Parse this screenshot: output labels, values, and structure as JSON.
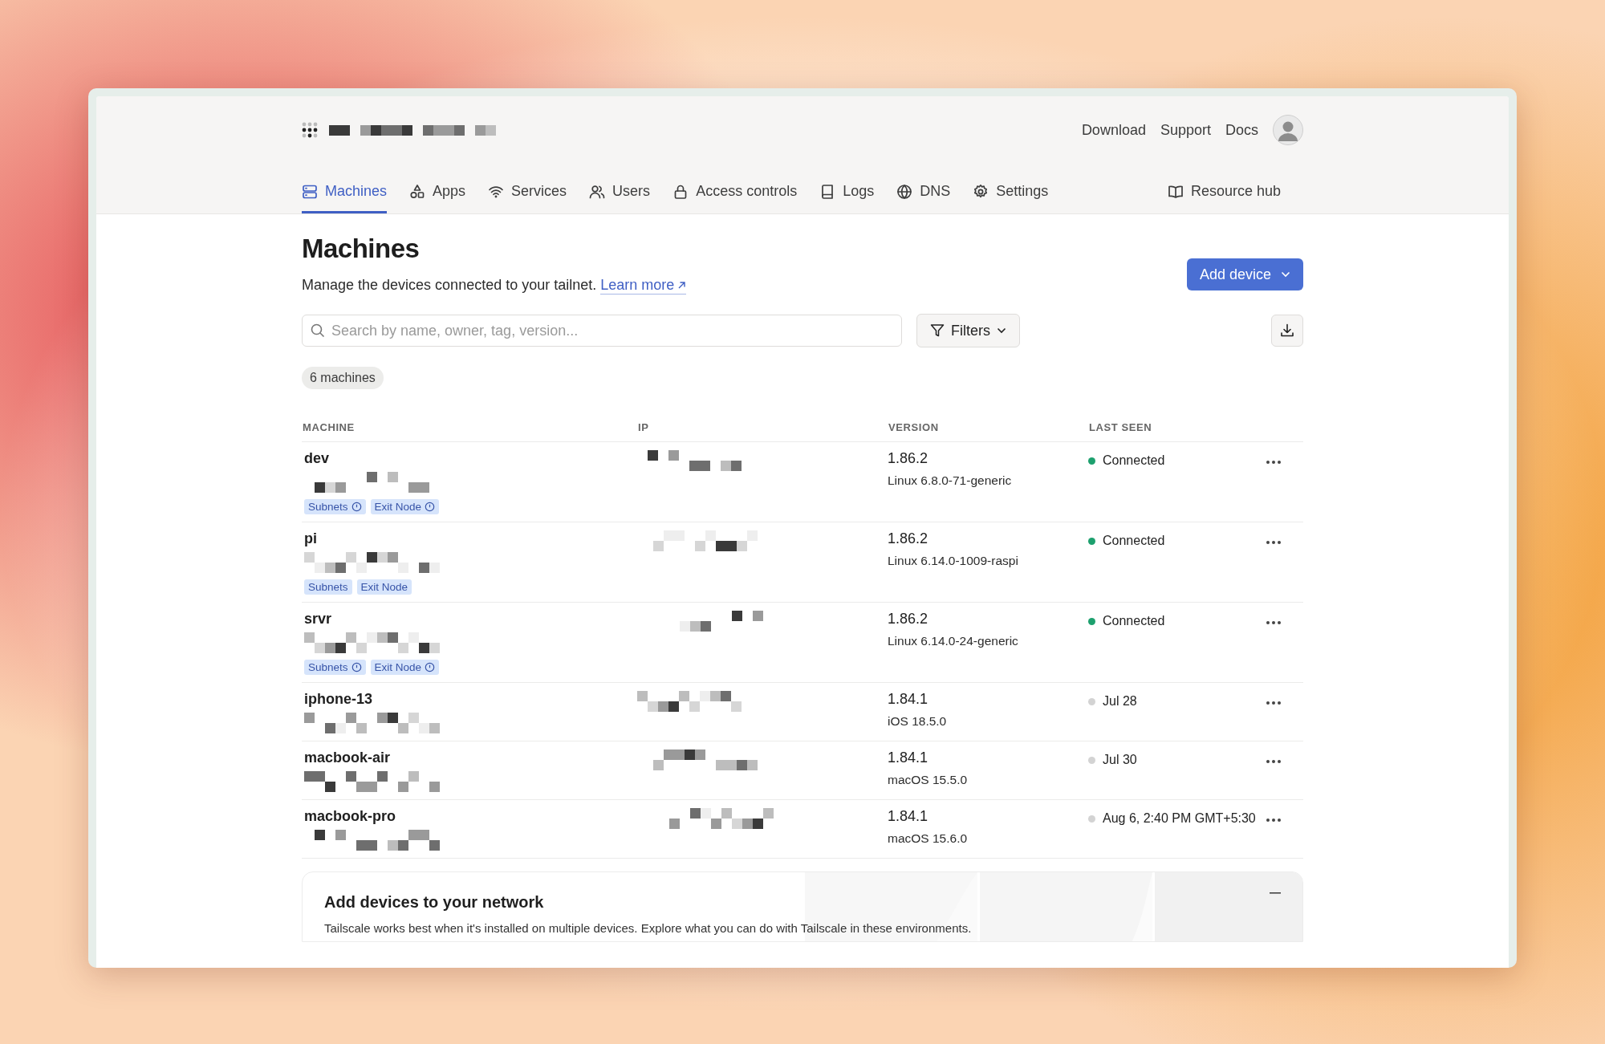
{
  "top_links": [
    "Download",
    "Support",
    "Docs"
  ],
  "nav_tabs": [
    {
      "label": "Machines",
      "selected": true
    },
    {
      "label": "Apps",
      "selected": false
    },
    {
      "label": "Services",
      "selected": false
    },
    {
      "label": "Users",
      "selected": false
    },
    {
      "label": "Access controls",
      "selected": false
    },
    {
      "label": "Logs",
      "selected": false
    },
    {
      "label": "DNS",
      "selected": false
    },
    {
      "label": "Settings",
      "selected": false
    }
  ],
  "resource_hub": "Resource hub",
  "page": {
    "title": "Machines",
    "description": "Manage the devices connected to your tailnet.",
    "link": "Learn more"
  },
  "add_device_button": "Add device",
  "search": {
    "placeholder": "Search by name, owner, tag, version..."
  },
  "filters_button": "Filters",
  "count_badge": "6 machines",
  "table": {
    "columns": [
      "MACHINE",
      "IP",
      "VERSION",
      "LAST SEEN"
    ],
    "rows": [
      {
        "name": "dev",
        "tags": [
          {
            "label": "Subnets",
            "info": true
          },
          {
            "label": "Exit Node",
            "info": true
          }
        ],
        "version": "1.86.2",
        "os": "Linux 6.8.0-71-generic",
        "last_seen": "Connected",
        "connected": true
      },
      {
        "name": "pi",
        "tags": [
          {
            "label": "Subnets",
            "info": false
          },
          {
            "label": "Exit Node",
            "info": false
          }
        ],
        "version": "1.86.2",
        "os": "Linux 6.14.0-1009-raspi",
        "last_seen": "Connected",
        "connected": true
      },
      {
        "name": "srvr",
        "tags": [
          {
            "label": "Subnets",
            "info": true
          },
          {
            "label": "Exit Node",
            "info": true
          }
        ],
        "version": "1.86.2",
        "os": "Linux 6.14.0-24-generic",
        "last_seen": "Connected",
        "connected": true
      },
      {
        "name": "iphone-13",
        "version": "1.84.1",
        "os": "iOS 18.5.0",
        "last_seen": "Jul 28",
        "connected": false
      },
      {
        "name": "macbook-air",
        "version": "1.84.1",
        "os": "macOS 15.5.0",
        "last_seen": "Jul 30",
        "connected": false
      },
      {
        "name": "macbook-pro",
        "version": "1.84.1",
        "os": "macOS 15.6.0",
        "last_seen": "Aug 6, 2:40 PM GMT+5:30",
        "connected": false
      }
    ]
  },
  "add_devices_card": {
    "title": "Add devices to your network",
    "text": "Tailscale works best when it's installed on multiple devices. Explore what you can do with Tailscale in these environments."
  }
}
